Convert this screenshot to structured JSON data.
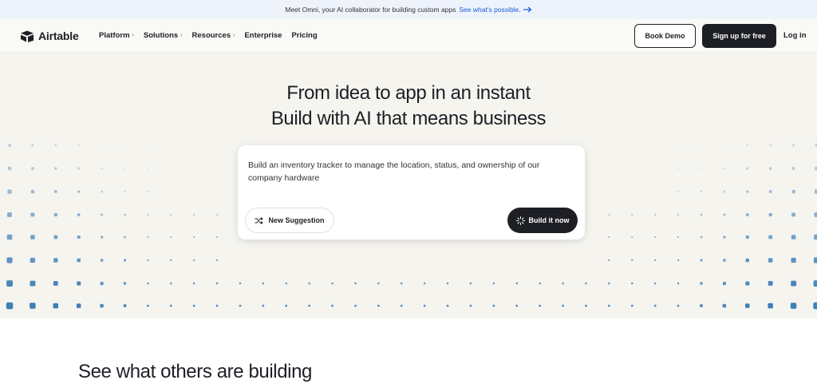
{
  "banner": {
    "text": "Meet Omni, your AI collaborator for building custom apps",
    "link": "See what's possible.",
    "link_icon": "arrow-right-icon"
  },
  "nav": {
    "brand": "Airtable",
    "brand_icon": "airtable-logo-icon",
    "items": [
      {
        "label": "Platform",
        "has_chevron": true
      },
      {
        "label": "Solutions",
        "has_chevron": true
      },
      {
        "label": "Resources",
        "has_chevron": true
      },
      {
        "label": "Enterprise",
        "has_chevron": false
      },
      {
        "label": "Pricing",
        "has_chevron": false
      }
    ],
    "book_demo": "Book Demo",
    "signup": "Sign up for free",
    "login": "Log in"
  },
  "hero": {
    "title_line1": "From idea to app in an instant",
    "title_line2": "Build with AI that means business",
    "prompt": "Build an inventory tracker to manage the location, status, and ownership of our company hardware",
    "new_suggestion": "New Suggestion",
    "new_suggestion_icon": "shuffle-icon",
    "build": "Build it now",
    "build_icon": "spinner-icon"
  },
  "section": {
    "title": "See what others are building"
  },
  "colors": {
    "dark": "#1d1f25",
    "banner_bg": "#eef2fb",
    "link": "#1a5fd6",
    "hero_bg": "#f5f4ef",
    "dot_light": "#dbe3ea",
    "dot_dark": "#3f7fb6"
  }
}
